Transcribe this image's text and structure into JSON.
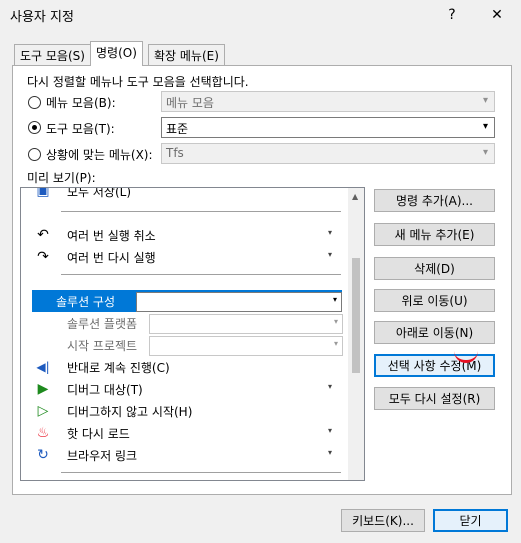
{
  "window": {
    "title": "사용자 지정",
    "help": "?",
    "close": "✕"
  },
  "tabs": [
    {
      "label": "도구 모음(S)",
      "active": false
    },
    {
      "label": "명령(O)",
      "active": true
    },
    {
      "label": "확장 메뉴(E)",
      "active": false
    }
  ],
  "instruction": "다시 정렬할 메뉴나 도구 모음을 선택합니다.",
  "options": [
    {
      "label": "메뉴 모음(B):",
      "selected": false,
      "value": "메뉴 모음",
      "enabled": false
    },
    {
      "label": "도구 모음(T):",
      "selected": true,
      "value": "표준",
      "enabled": true
    },
    {
      "label": "상황에 맞는 메뉴(X):",
      "selected": false,
      "value": "Tfs",
      "enabled": false
    }
  ],
  "preview_label": "미리 보기(P):",
  "preview": {
    "top_partial": "모두 저장(L)",
    "items": [
      {
        "icon": "undo-icon",
        "text": "여러 번 실행 취소",
        "dropdown": true
      },
      {
        "icon": "redo-icon",
        "text": "여러 번 다시 실행",
        "dropdown": true
      },
      {
        "text": "솔루션 구성",
        "selected": true,
        "combo": true
      },
      {
        "text": "솔루션 플랫폼",
        "disabled": true,
        "combo": true
      },
      {
        "text": "시작 프로젝트",
        "disabled": true,
        "combo": true
      },
      {
        "icon": "step-back-icon",
        "text": "반대로 계속 진행(C)"
      },
      {
        "icon": "play-icon",
        "text": "디버그 대상(T)",
        "dropdown": true
      },
      {
        "icon": "play-outline-icon",
        "text": "디버그하지 않고 시작(H)"
      },
      {
        "icon": "hot-reload-icon",
        "text": "핫 다시 로드",
        "dropdown": true
      },
      {
        "icon": "browser-link-icon",
        "text": "브라우저 링크",
        "dropdown": true
      }
    ]
  },
  "buttons": {
    "add_command": "명령 추가(A)...",
    "add_menu": "새 메뉴 추가(E)",
    "delete": "삭제(D)",
    "move_up": "위로 이동(U)",
    "move_down": "아래로 이동(N)",
    "modify_selection": "선택 사항 수정(M)",
    "reset_all": "모두 다시 설정(R)"
  },
  "footer": {
    "keyboard": "키보드(K)...",
    "close": "닫기"
  },
  "colors": {
    "selection": "#0078d7",
    "accent_red": "#e81123",
    "play_green": "#1e8a1e",
    "step_blue": "#1e5bbf"
  }
}
